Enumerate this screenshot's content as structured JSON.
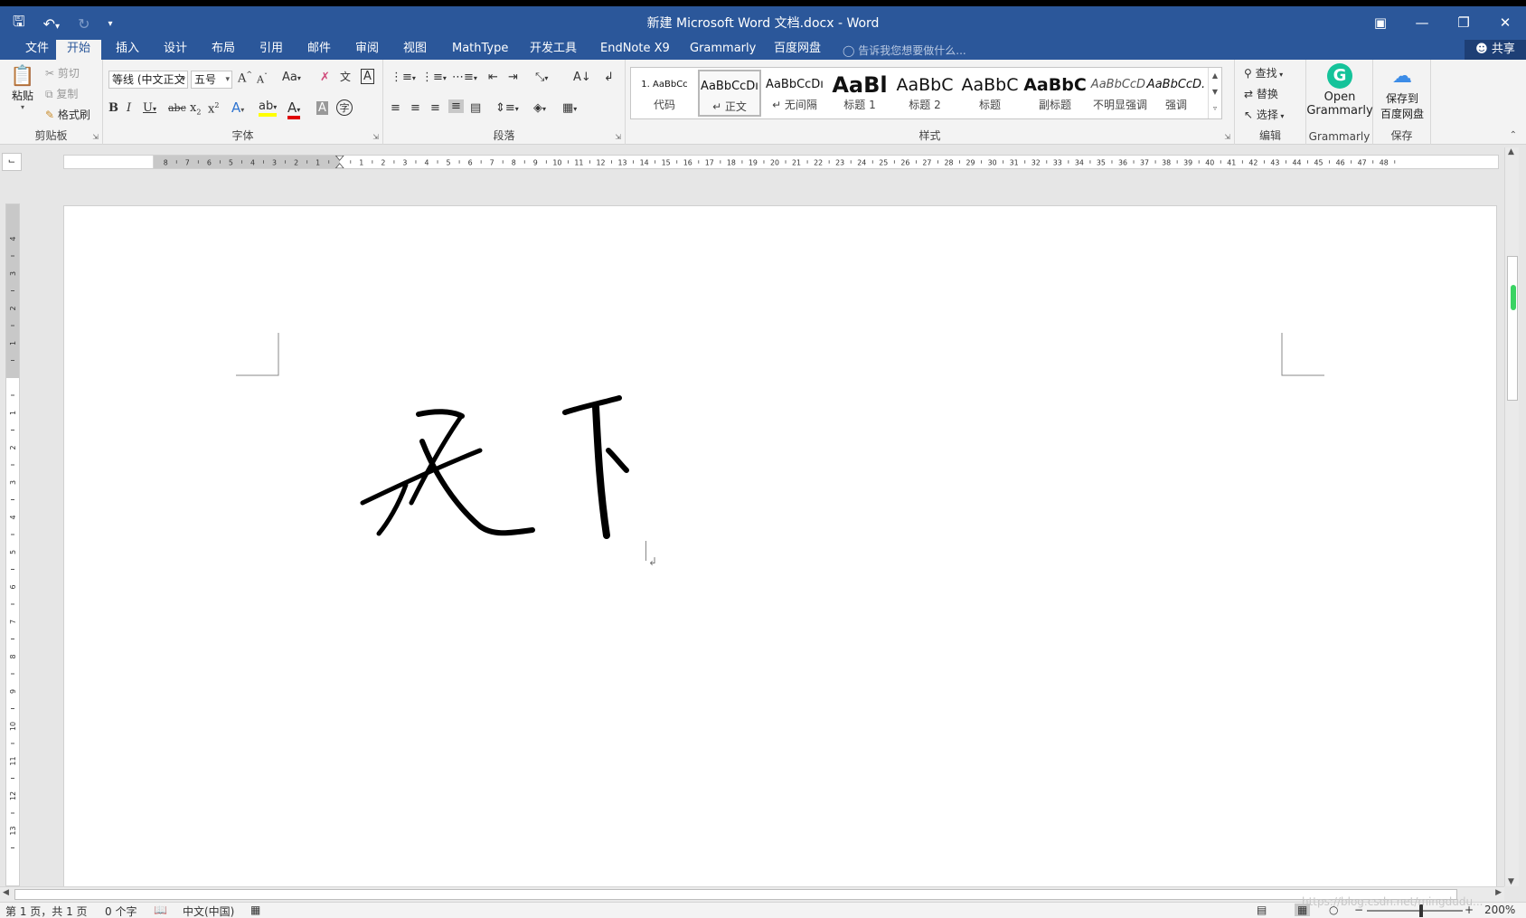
{
  "titlebar": {
    "title": "新建 Microsoft Word 文档.docx - Word",
    "icons": [
      "save-icon",
      "undo-icon",
      "redo-icon",
      "customize-qat-icon"
    ]
  },
  "tabs": [
    {
      "label": "文件",
      "active": false
    },
    {
      "label": "开始",
      "active": true
    },
    {
      "label": "插入",
      "active": false
    },
    {
      "label": "设计",
      "active": false
    },
    {
      "label": "布局",
      "active": false
    },
    {
      "label": "引用",
      "active": false
    },
    {
      "label": "邮件",
      "active": false
    },
    {
      "label": "审阅",
      "active": false
    },
    {
      "label": "视图",
      "active": false
    },
    {
      "label": "MathType",
      "active": false
    },
    {
      "label": "开发工具",
      "active": false
    },
    {
      "label": "EndNote X9",
      "active": false
    },
    {
      "label": "Grammarly",
      "active": false
    },
    {
      "label": "百度网盘",
      "active": false
    }
  ],
  "tell_me": "告诉我您想要做什么...",
  "share": "共享",
  "clipboard": {
    "paste": "粘贴",
    "cut": "剪切",
    "copy": "复制",
    "format_painter": "格式刷",
    "group": "剪贴板"
  },
  "font": {
    "name": "等线 (中文正文",
    "size": "五号",
    "change_case": "Aa",
    "group": "字体"
  },
  "paragraph": {
    "group": "段落"
  },
  "styles": {
    "group": "样式",
    "items": [
      {
        "sample": "1.   AaBbCc",
        "name": "代码"
      },
      {
        "sample": "AaBbCcDı",
        "name": "↵ 正文",
        "selected": true
      },
      {
        "sample": "AaBbCcDı",
        "name": "↵ 无间隔"
      },
      {
        "sample": "AaBl",
        "name": "标题 1"
      },
      {
        "sample": "AaBbC",
        "name": "标题 2"
      },
      {
        "sample": "AaBbC",
        "name": "标题"
      },
      {
        "sample": "AaBbC",
        "name": "副标题"
      },
      {
        "sample": "AaBbCcD.",
        "name": "不明显强调"
      },
      {
        "sample": "AaBbCcD.",
        "name": "强调"
      }
    ]
  },
  "editing": {
    "find": "查找",
    "replace": "替换",
    "select": "选择",
    "group": "编辑"
  },
  "grammarly": {
    "button_line1": "Open",
    "button_line2": "Grammarly",
    "group": "Grammarly"
  },
  "baidu": {
    "button_line1": "保存到",
    "button_line2": "百度网盘",
    "group": "保存"
  },
  "status": {
    "page": "第 1 页，共 1 页",
    "words": "0 个字",
    "language": "中文(中国)",
    "zoom": "200%",
    "watermark": "https://blog.csdn.net/mingdudu..."
  },
  "colors": {
    "brand": "#2b579a",
    "highlight": "#ffff00",
    "font_color": "#e00000",
    "grammarly": "#15c39a"
  }
}
